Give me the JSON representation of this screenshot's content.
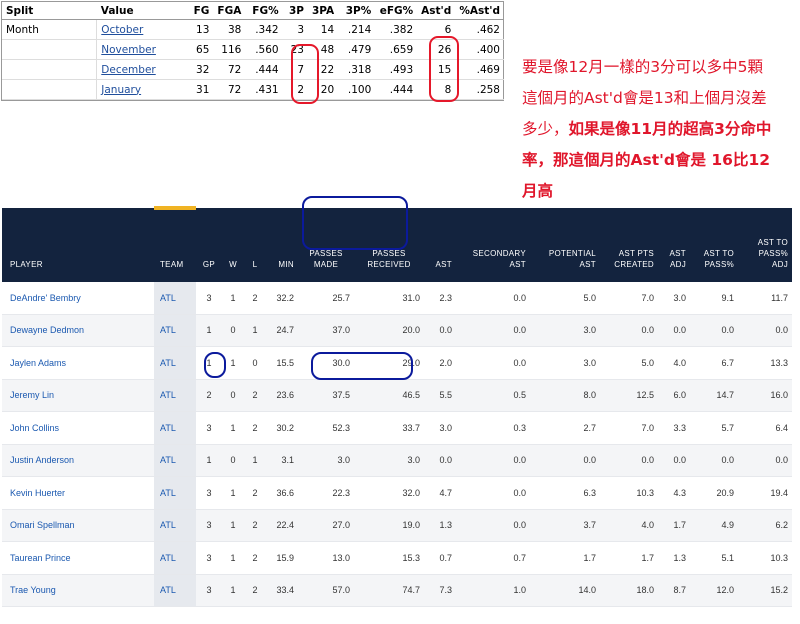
{
  "split_table": {
    "headers": [
      "Split",
      "Value",
      "FG",
      "FGA",
      "FG%",
      "3P",
      "3PA",
      "3P%",
      "eFG%",
      "Ast'd",
      "%Ast'd"
    ],
    "rows": [
      {
        "split": "Month",
        "value": "October",
        "fg": "13",
        "fga": "38",
        "fg_pct": ".342",
        "tp": "3",
        "tpa": "14",
        "tp_pct": ".214",
        "efg": ".382",
        "astd": "6",
        "astd_pct": ".462"
      },
      {
        "split": "",
        "value": "November",
        "fg": "65",
        "fga": "116",
        "fg_pct": ".560",
        "tp": "23",
        "tpa": "48",
        "tp_pct": ".479",
        "efg": ".659",
        "astd": "26",
        "astd_pct": ".400"
      },
      {
        "split": "",
        "value": "December",
        "fg": "32",
        "fga": "72",
        "fg_pct": ".444",
        "tp": "7",
        "tpa": "22",
        "tp_pct": ".318",
        "efg": ".493",
        "astd": "15",
        "astd_pct": ".469"
      },
      {
        "split": "",
        "value": "January",
        "fg": "31",
        "fga": "72",
        "fg_pct": ".431",
        "tp": "2",
        "tpa": "20",
        "tp_pct": ".100",
        "efg": ".444",
        "astd": "8",
        "astd_pct": ".258"
      }
    ]
  },
  "annotation": {
    "line1": "要是像12月一樣的3分可以多中5顆",
    "line2": "這個月的Ast'd會是13和上個月沒差",
    "line3a": "多少，",
    "line3b": "如果是像11月的超高3分命中",
    "line4": "率，那這個月的Ast'd會是 16比12",
    "line5": "月高"
  },
  "stats_table": {
    "headers": {
      "player": "PLAYER",
      "team": "TEAM",
      "gp": "GP",
      "w": "W",
      "l": "L",
      "min": "MIN",
      "passes_made": "PASSES MADE",
      "passes_received": "PASSES RECEIVED",
      "ast": "AST",
      "secondary_ast": "SECONDARY AST",
      "potential_ast": "POTENTIAL AST",
      "ast_pts_created": "AST PTS CREATED",
      "ast_adj": "AST ADJ",
      "ast_to_pass": "AST TO PASS%",
      "ast_to_pass_adj": "AST TO PASS% ADJ"
    },
    "rows": [
      {
        "player": "DeAndre' Bembry",
        "team": "ATL",
        "gp": "3",
        "w": "1",
        "l": "2",
        "min": "32.2",
        "pm": "25.7",
        "pr": "31.0",
        "ast": "2.3",
        "sec": "0.0",
        "pot": "5.0",
        "apc": "7.0",
        "adj": "3.0",
        "atp": "9.1",
        "atpa": "11.7"
      },
      {
        "player": "Dewayne Dedmon",
        "team": "ATL",
        "gp": "1",
        "w": "0",
        "l": "1",
        "min": "24.7",
        "pm": "37.0",
        "pr": "20.0",
        "ast": "0.0",
        "sec": "0.0",
        "pot": "3.0",
        "apc": "0.0",
        "adj": "0.0",
        "atp": "0.0",
        "atpa": "0.0"
      },
      {
        "player": "Jaylen Adams",
        "team": "ATL",
        "gp": "1",
        "w": "1",
        "l": "0",
        "min": "15.5",
        "pm": "30.0",
        "pr": "29.0",
        "ast": "2.0",
        "sec": "0.0",
        "pot": "3.0",
        "apc": "5.0",
        "adj": "4.0",
        "atp": "6.7",
        "atpa": "13.3"
      },
      {
        "player": "Jeremy Lin",
        "team": "ATL",
        "gp": "2",
        "w": "0",
        "l": "2",
        "min": "23.6",
        "pm": "37.5",
        "pr": "46.5",
        "ast": "5.5",
        "sec": "0.5",
        "pot": "8.0",
        "apc": "12.5",
        "adj": "6.0",
        "atp": "14.7",
        "atpa": "16.0"
      },
      {
        "player": "John Collins",
        "team": "ATL",
        "gp": "3",
        "w": "1",
        "l": "2",
        "min": "30.2",
        "pm": "52.3",
        "pr": "33.7",
        "ast": "3.0",
        "sec": "0.3",
        "pot": "2.7",
        "apc": "7.0",
        "adj": "3.3",
        "atp": "5.7",
        "atpa": "6.4"
      },
      {
        "player": "Justin Anderson",
        "team": "ATL",
        "gp": "1",
        "w": "0",
        "l": "1",
        "min": "3.1",
        "pm": "3.0",
        "pr": "3.0",
        "ast": "0.0",
        "sec": "0.0",
        "pot": "0.0",
        "apc": "0.0",
        "adj": "0.0",
        "atp": "0.0",
        "atpa": "0.0"
      },
      {
        "player": "Kevin Huerter",
        "team": "ATL",
        "gp": "3",
        "w": "1",
        "l": "2",
        "min": "36.6",
        "pm": "22.3",
        "pr": "32.0",
        "ast": "4.7",
        "sec": "0.0",
        "pot": "6.3",
        "apc": "10.3",
        "adj": "4.3",
        "atp": "20.9",
        "atpa": "19.4"
      },
      {
        "player": "Omari Spellman",
        "team": "ATL",
        "gp": "3",
        "w": "1",
        "l": "2",
        "min": "22.4",
        "pm": "27.0",
        "pr": "19.0",
        "ast": "1.3",
        "sec": "0.0",
        "pot": "3.7",
        "apc": "4.0",
        "adj": "1.7",
        "atp": "4.9",
        "atpa": "6.2"
      },
      {
        "player": "Taurean Prince",
        "team": "ATL",
        "gp": "3",
        "w": "1",
        "l": "2",
        "min": "15.9",
        "pm": "13.0",
        "pr": "15.3",
        "ast": "0.7",
        "sec": "0.7",
        "pot": "1.7",
        "apc": "1.7",
        "adj": "1.3",
        "atp": "5.1",
        "atpa": "10.3"
      },
      {
        "player": "Trae Young",
        "team": "ATL",
        "gp": "3",
        "w": "1",
        "l": "2",
        "min": "33.4",
        "pm": "57.0",
        "pr": "74.7",
        "ast": "7.3",
        "sec": "1.0",
        "pot": "14.0",
        "apc": "18.0",
        "adj": "8.7",
        "atp": "12.0",
        "atpa": "15.2"
      }
    ]
  },
  "colors": {
    "annotation_red": "#e0162b",
    "circle_blue": "#0b1a9c",
    "header_navy": "#13233e",
    "team_gold": "#f0b323",
    "link_blue": "#1b59b0"
  }
}
